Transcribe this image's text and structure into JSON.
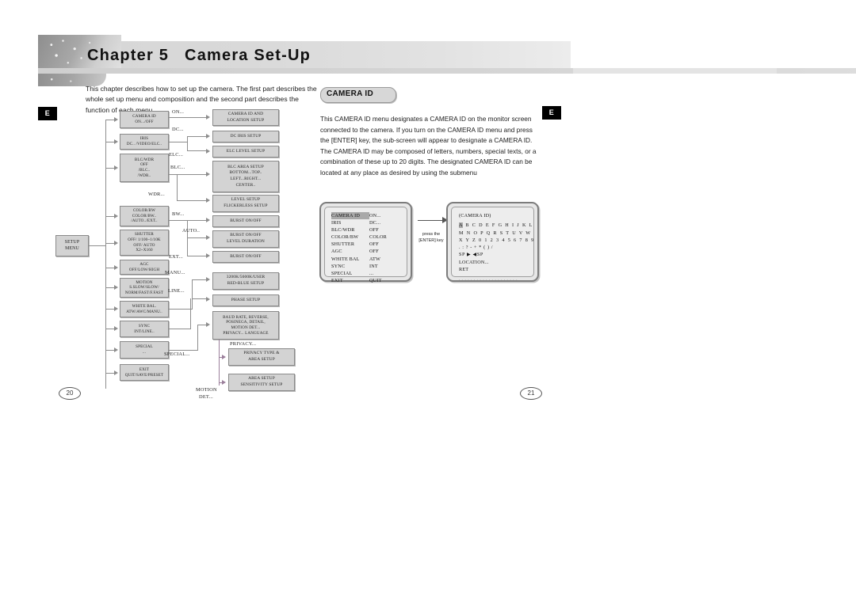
{
  "header": {
    "chapter": "Chapter 5",
    "title": "Camera Set-Up"
  },
  "left_page": {
    "intro": "This chapter describes how to set up the camera. The first part describes the whole set up menu and composition and the second part describes the function of each menu.",
    "lang_badge": "E",
    "page_number": "20",
    "diagram": {
      "root": [
        "SETUP",
        "MENU"
      ],
      "menu_nodes": [
        {
          "name": "camera-id",
          "lines": [
            "CAMERA ID",
            "ON.../OFF"
          ]
        },
        {
          "name": "iris",
          "lines": [
            "IRIS",
            "DC.. /VIDEO/ELC.."
          ]
        },
        {
          "name": "blc-wdr",
          "lines": [
            "BLC/WDR",
            "OFF",
            "/BLC..",
            "/WDR.."
          ]
        },
        {
          "name": "color-bw",
          "lines": [
            "COLOR/BW",
            "COLOR/BW..",
            "/AUTO../EXT.."
          ]
        },
        {
          "name": "shutter",
          "lines": [
            "SHUTTER",
            "OFF/ 1/100~1/10K",
            "OFF/ AUTO",
            "X2~X160"
          ]
        },
        {
          "name": "agc",
          "lines": [
            "AGC",
            "OFF/LOW/HIGH"
          ]
        },
        {
          "name": "motion",
          "lines": [
            "MOTION",
            "S.SLOW/SLOW/",
            "NORM/FAST/F.FAST"
          ]
        },
        {
          "name": "white-bal",
          "lines": [
            "WHITE BAL.",
            "ATW/AWC/MANU.."
          ]
        },
        {
          "name": "sync",
          "lines": [
            "SYNC",
            "INT/LINE.."
          ]
        },
        {
          "name": "special",
          "lines": [
            "SPECIAL",
            "..."
          ]
        },
        {
          "name": "exit",
          "lines": [
            "EXIT",
            "QUIT/SAVE/PRESET"
          ]
        }
      ],
      "sub_nodes": [
        {
          "name": "camera-id-location-setup",
          "lines": [
            "CAMERA ID AND",
            "LOCATION SETUP"
          ]
        },
        {
          "name": "dc-iris-setup",
          "lines": [
            "DC IRIS SETUP"
          ]
        },
        {
          "name": "elc-level-setup",
          "lines": [
            "ELC LEVEL  SETUP"
          ]
        },
        {
          "name": "blc-area-setup",
          "lines": [
            "BLC AREA SETUP",
            "BOTTOM...TOP..",
            "LEFT...RIGHT...",
            "CENTER.."
          ]
        },
        {
          "name": "level-flickerless-setup",
          "lines": [
            "LEVEL SETUP",
            "FLICKERLESS SETUP"
          ]
        },
        {
          "name": "burst-on-off-bw",
          "lines": [
            "BURST ON/OFF"
          ]
        },
        {
          "name": "burst-level-duration",
          "lines": [
            "BURST ON/OFF",
            "LEVEL DURATION"
          ]
        },
        {
          "name": "burst-on-off-ext",
          "lines": [
            "BURST ON/OFF"
          ]
        },
        {
          "name": "red-blue-setup",
          "lines": [
            "3200K/5600K/USER",
            "RED-BLUE SETUP"
          ]
        },
        {
          "name": "phase-setup",
          "lines": [
            "PHASE  SETUP"
          ]
        },
        {
          "name": "special-submenu",
          "lines": [
            "BAUD RATE, REVERSE,",
            "POSINEGA, DETAIL,",
            "MOTION DET...",
            "PRIVACY... LANGUAGE"
          ]
        },
        {
          "name": "privacy-area-setup",
          "lines": [
            "PRIVACY TYPE &",
            "AREA  SETUP"
          ]
        },
        {
          "name": "motion-area-sensitivity",
          "lines": [
            "AREA  SETUP",
            "SENSITIVITY SETUP"
          ]
        }
      ],
      "edge_labels": [
        {
          "name": "on",
          "text": "ON..."
        },
        {
          "name": "dc",
          "text": "DC..."
        },
        {
          "name": "elc",
          "text": "ELC..."
        },
        {
          "name": "blc",
          "text": "BLC..."
        },
        {
          "name": "wdr",
          "text": "WDR..."
        },
        {
          "name": "bw",
          "text": "BW..."
        },
        {
          "name": "auto",
          "text": "AUTO.."
        },
        {
          "name": "ext",
          "text": "EXT..."
        },
        {
          "name": "manu",
          "text": "MANU..."
        },
        {
          "name": "line",
          "text": "LINE..."
        },
        {
          "name": "special",
          "text": "SPECIAL..."
        },
        {
          "name": "privacy",
          "text": "PRIVACY..."
        },
        {
          "name": "motion-det-1",
          "text": "MOTION"
        },
        {
          "name": "motion-det-2",
          "text": "DET..."
        }
      ]
    }
  },
  "right_page": {
    "section_title": "CAMERA ID",
    "lang_badge": "E",
    "page_number": "21",
    "body": "This CAMERA ID menu designates a CAMERA ID on the monitor screen connected to the camera. If you turn on the CAMERA ID menu and press the [ENTER] key, the sub-screen will appear to designate a CAMERA ID. The CAMERA ID may be composed of letters, numbers,  special texts, or a combination of these up to 20 digits. The designated CAMERA ID can be located at any place as desired by using the submenu",
    "transition_note": [
      "press the",
      "[ENTER] key"
    ],
    "osd_main": {
      "rows": [
        {
          "key": "CAMERA ID",
          "value": "ON...",
          "selected": true
        },
        {
          "key": "IRIS",
          "value": "DC...",
          "selected": false
        },
        {
          "key": "BLC/WDR",
          "value": "OFF",
          "selected": false
        },
        {
          "key": "COLOR/BW",
          "value": "COLOR",
          "selected": false
        },
        {
          "key": "SHUTTER",
          "value": "OFF",
          "selected": false
        },
        {
          "key": "AGC",
          "value": "OFF",
          "selected": false
        },
        {
          "key": "WHITE BAL",
          "value": "ATW",
          "selected": false
        },
        {
          "key": "SYNC",
          "value": "INT",
          "selected": false
        },
        {
          "key": "SPECIAL",
          "value": "...",
          "selected": false
        },
        {
          "key": "EXIT",
          "value": "QUIT",
          "selected": false
        }
      ]
    },
    "osd_id": {
      "title": "(CAMERA ID)",
      "char_row_1_selected": "A",
      "char_row_1": "B C D E F G H I J K L",
      "char_row_2": "M N O P Q R S T U V W",
      "char_row_3": "X Y Z 0 1 2 3 4 5 6 7 8 9",
      "char_row_4": ". : ? - + * ( ) /",
      "nav_row": "SP ▶ ◀SP",
      "location_row": "LOCATION...",
      "ret_row": "RET",
      "footer": "▪ ▪ ▪ ▪ ▪ ▪ ▪ ▪ ▪ ▪ ▪ ▪ ▪ ▪ ▪ ▪ ▪ ▪ ▪ ▪"
    }
  }
}
